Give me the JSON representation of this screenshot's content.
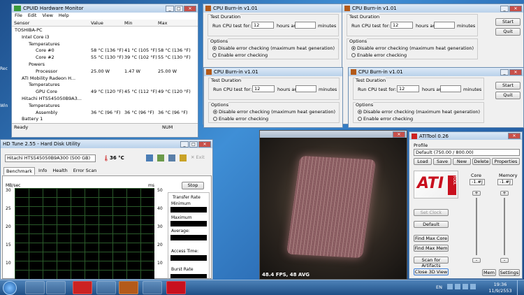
{
  "hwm": {
    "title": "CPUID Hardware Monitor",
    "menu": [
      "File",
      "Edit",
      "View",
      "Help"
    ],
    "headers": [
      "Sensor",
      "Value",
      "Min",
      "Max"
    ],
    "rows": [
      {
        "indent": 0,
        "name": "TOSHIBA-PC",
        "v": "",
        "mn": "",
        "mx": ""
      },
      {
        "indent": 1,
        "name": "Intel Core i3",
        "v": "",
        "mn": "",
        "mx": ""
      },
      {
        "indent": 2,
        "name": "Temperatures",
        "v": "",
        "mn": "",
        "mx": ""
      },
      {
        "indent": 3,
        "name": "Core #0",
        "v": "58 °C (136 °F)",
        "mn": "41 °C (105 °F)",
        "mx": "58 °C (136 °F)"
      },
      {
        "indent": 3,
        "name": "Core #2",
        "v": "55 °C (130 °F)",
        "mn": "39 °C (102 °F)",
        "mx": "55 °C (130 °F)"
      },
      {
        "indent": 2,
        "name": "Powers",
        "v": "",
        "mn": "",
        "mx": ""
      },
      {
        "indent": 3,
        "name": "Processor",
        "v": "25.00 W",
        "mn": "1.47 W",
        "mx": "25.00 W"
      },
      {
        "indent": 1,
        "name": "ATI Mobility Radeon H...",
        "v": "",
        "mn": "",
        "mx": ""
      },
      {
        "indent": 2,
        "name": "Temperatures",
        "v": "",
        "mn": "",
        "mx": ""
      },
      {
        "indent": 3,
        "name": "GPU Core",
        "v": "49 °C (120 °F)",
        "mn": "45 °C (112 °F)",
        "mx": "49 °C (120 °F)"
      },
      {
        "indent": 1,
        "name": "Hitachi HTS545050B9A3...",
        "v": "",
        "mn": "",
        "mx": ""
      },
      {
        "indent": 2,
        "name": "Temperatures",
        "v": "",
        "mn": "",
        "mx": ""
      },
      {
        "indent": 3,
        "name": "Assembly",
        "v": "36 °C (96 °F)",
        "mn": "36 °C (96 °F)",
        "mx": "36 °C (96 °F)"
      },
      {
        "indent": 1,
        "name": "Battery 1",
        "v": "",
        "mn": "",
        "mx": ""
      }
    ],
    "status": "Ready",
    "num": "NUM"
  },
  "burnin": {
    "title": "CPU Burn-in v1.01",
    "duration_label": "Test Duration",
    "run_label": "Run CPU test for:",
    "hours": "12",
    "hours_label": "hours and",
    "minutes_label": "minutes",
    "options_label": "Options",
    "opt1": "Disable error checking (maximum heat generation)",
    "opt2": "Enable error checking",
    "start": "Start",
    "quit": "Quit"
  },
  "hdtune": {
    "title": "HD Tune 2.55 - Hard Disk Utility",
    "drive": "Hitachi HTS545050B9A300 (500 GB)",
    "temp": "36 °C",
    "tabs": [
      "Benchmark",
      "Info",
      "Health",
      "Error Scan"
    ],
    "exit": "Exit",
    "y_left_unit": "MB/sec",
    "y_right_unit": "ms",
    "y_left": [
      "30",
      "25",
      "20",
      "15",
      "10"
    ],
    "y_right": [
      "50",
      "40",
      "30",
      "20",
      "10"
    ],
    "stop": "Stop",
    "transfer": "Transfer Rate",
    "minimum": "Minimum",
    "maximum": "Maximum",
    "average": "Average:",
    "access": "Access Time:",
    "burst": "Burst Rate"
  },
  "fur": {
    "fps": "48.4 FPS, 48 AVG"
  },
  "ati": {
    "title": "ATITool 0.26",
    "profile_label": "Profile",
    "profile": "Default (750.00 / 800.00)",
    "buttons": [
      "Load",
      "Save",
      "New",
      "Delete",
      "Properties"
    ],
    "core_label": "Core",
    "mem_label": "Memory",
    "core_val": "-1.#J",
    "mem_val": "-1.#J",
    "set_clock": "Set Clock",
    "default": "Default",
    "find_core": "Find Max Core",
    "find_mem": "Find Max Mem",
    "scan": "Scan for Artifacts",
    "close3d": "Close 3D View",
    "mem": "Mem",
    "settings": "Settings",
    "logo": "ATI",
    "logo2": "TOOL"
  },
  "taskbar": {
    "lang": "EN",
    "time": "19:36",
    "date": "11/9/2553"
  },
  "desktop": {
    "icons": [
      "Rec",
      "Win"
    ]
  }
}
